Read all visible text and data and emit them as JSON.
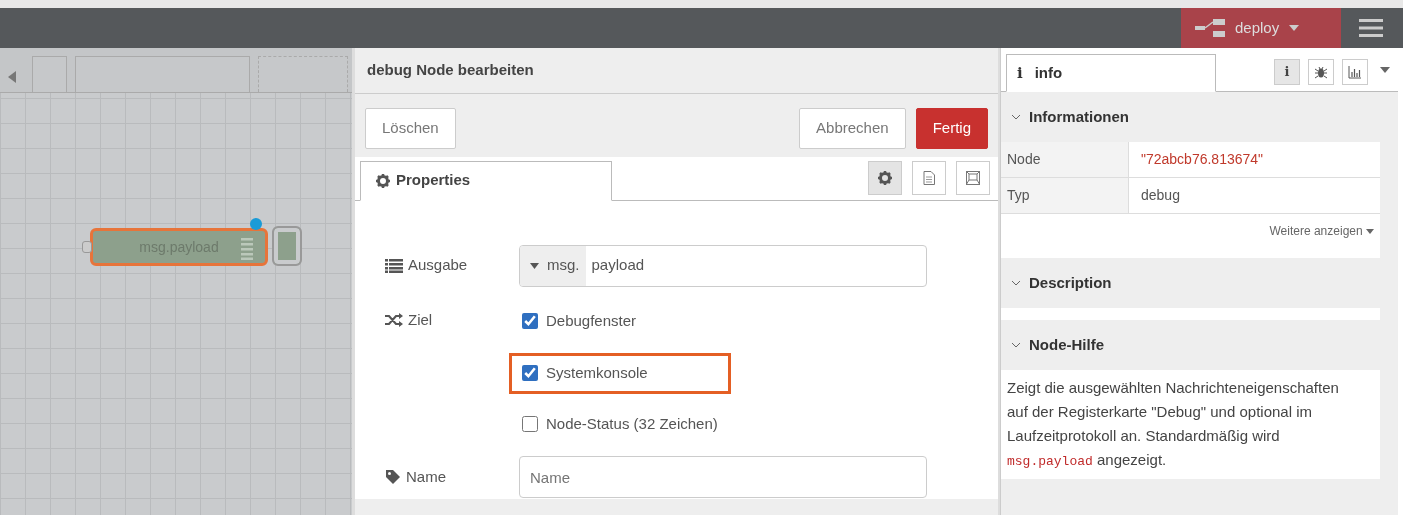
{
  "header": {
    "deploy": {
      "label": "deploy"
    }
  },
  "canvas": {
    "node": {
      "label": "msg.payload",
      "selected": true,
      "changed": true
    }
  },
  "editor": {
    "title": "debug Node bearbeiten",
    "buttons": [
      {
        "label": "Löschen",
        "kind": "default"
      },
      {
        "label": "Abbrechen",
        "kind": "default"
      },
      {
        "label": "Fertig",
        "kind": "primary"
      }
    ],
    "tabs": [
      {
        "label": "Properties",
        "selected": true
      }
    ],
    "tab_icons": [
      {
        "kind": "gear",
        "selected": true
      },
      {
        "kind": "document",
        "selected": false
      },
      {
        "kind": "frame",
        "selected": false
      }
    ],
    "output": {
      "label": "Ausgabe",
      "prefix": "msg.",
      "value": "payload"
    },
    "target": {
      "label": "Ziel",
      "options": [
        {
          "label": "Debugfenster",
          "checked": true,
          "highlighted": false
        },
        {
          "label": "Systemkonsole",
          "checked": true,
          "highlighted": true
        },
        {
          "label": "Node-Status (32 Zeichen)",
          "checked": false,
          "highlighted": false
        }
      ]
    },
    "name": {
      "label": "Name",
      "placeholder": "Name"
    }
  },
  "sidebar": {
    "tab": {
      "label": "info",
      "icon": "i"
    },
    "tab_icons": [
      {
        "kind": "info",
        "label": "i",
        "selected": true
      },
      {
        "kind": "bug",
        "selected": false
      },
      {
        "kind": "chart",
        "selected": false
      }
    ],
    "sections": [
      {
        "kind": "table",
        "title": "Informationen",
        "expanded": true,
        "rows": [
          {
            "key": "Node",
            "value": "\"72abcb76.813674\"",
            "kind": "id"
          },
          {
            "key": "Typ",
            "value": "debug",
            "kind": "plain"
          }
        ],
        "more": "Weitere anzeigen"
      },
      {
        "kind": "empty",
        "title": "Description",
        "expanded": true
      },
      {
        "kind": "help",
        "title": "Node-Hilfe",
        "expanded": true,
        "text_before": "Zeigt die ausgewählten Nachrichteneigenschaften auf der Registerkarte \"Debug\" und optional im Laufzeitprotokoll an. Standardmäßig wird ",
        "code": "msg.payload",
        "text_after": " angezeigt."
      }
    ]
  }
}
